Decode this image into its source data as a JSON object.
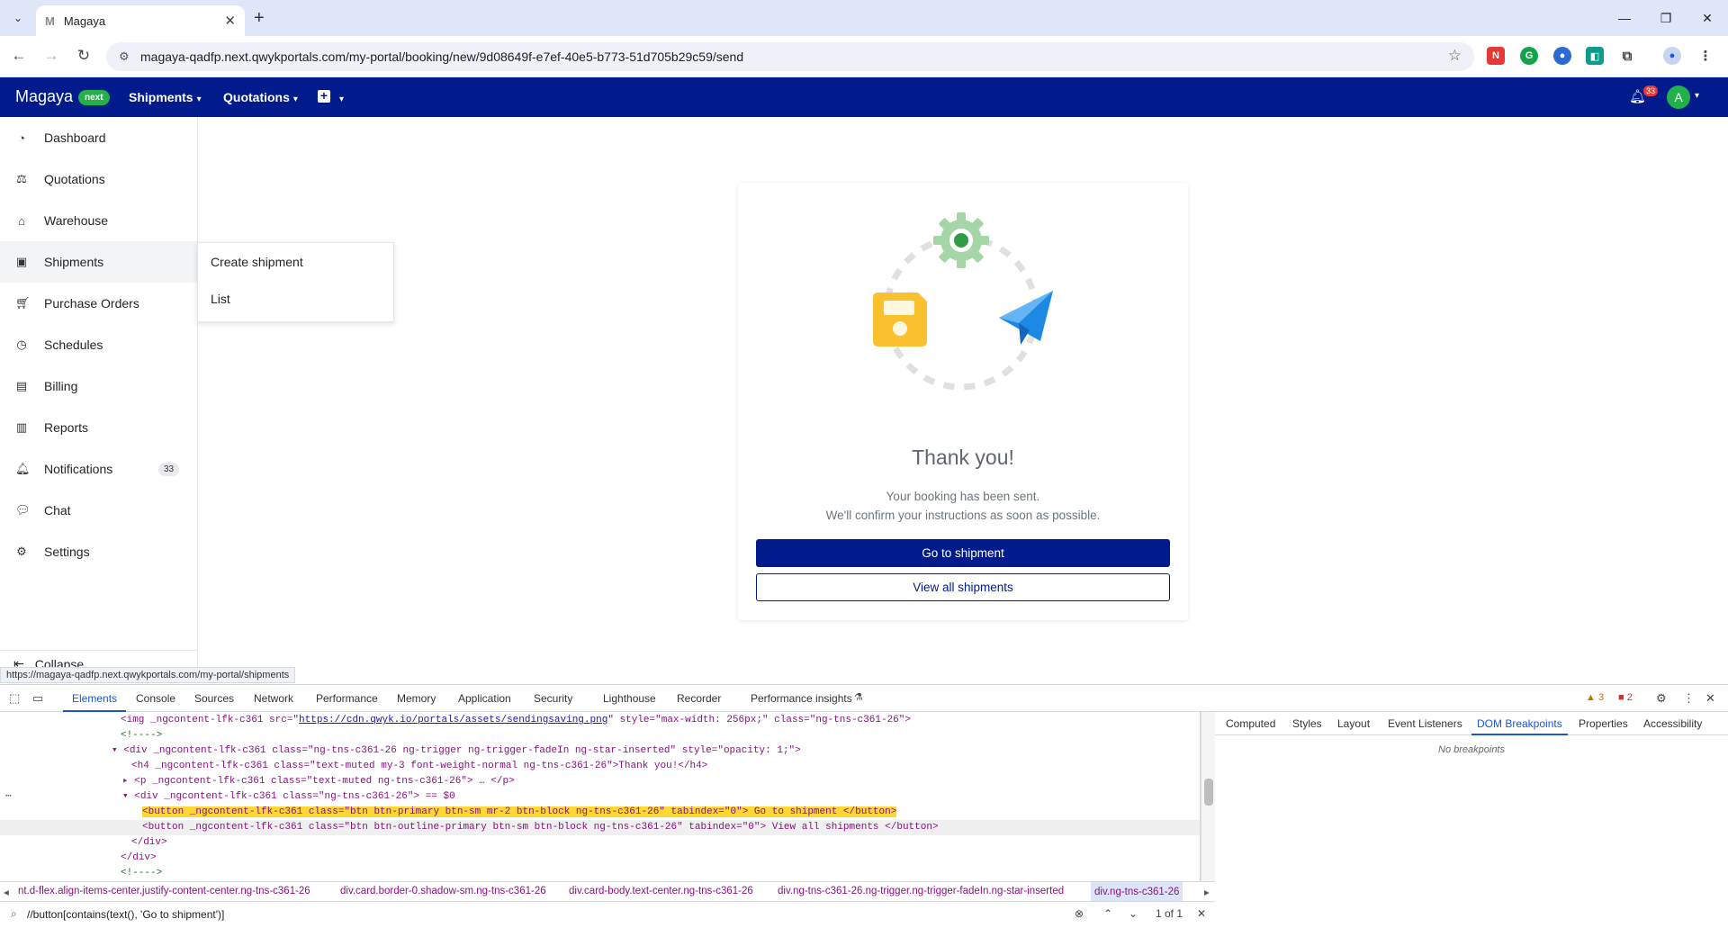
{
  "browser": {
    "tab_title": "Magaya",
    "tab_favicon": "M",
    "url": "magaya-qadfp.next.qwykportals.com/my-portal/booking/new/9d08649f-e7ef-40e5-b773-51d705b29c59/send"
  },
  "app": {
    "brand": "Magaya",
    "brand_badge": "next",
    "nav": {
      "shipments": "Shipments",
      "quotations": "Quotations"
    },
    "bell_count": "33",
    "avatar_initial": "A",
    "colors": {
      "primary": "#021b8c",
      "green": "#22b04b",
      "accent_yellow": "#fbc02d",
      "accent_blue": "#1e88e5"
    }
  },
  "sidebar": {
    "items": [
      {
        "label": "Dashboard",
        "icon": "gauge-icon"
      },
      {
        "label": "Quotations",
        "icon": "scale-icon"
      },
      {
        "label": "Warehouse",
        "icon": "warehouse-icon"
      },
      {
        "label": "Shipments",
        "icon": "box-icon"
      },
      {
        "label": "Purchase Orders",
        "icon": "cart-icon"
      },
      {
        "label": "Schedules",
        "icon": "clock-icon"
      },
      {
        "label": "Billing",
        "icon": "billing-icon"
      },
      {
        "label": "Reports",
        "icon": "chart-icon"
      },
      {
        "label": "Notifications",
        "icon": "bell-icon",
        "badge": "33"
      },
      {
        "label": "Chat",
        "icon": "chat-icon"
      },
      {
        "label": "Settings",
        "icon": "gear-icon"
      }
    ],
    "collapse": "Collapse"
  },
  "flyout": {
    "create": "Create shipment",
    "list": "List"
  },
  "card": {
    "title": "Thank you!",
    "line1": "Your booking has been sent.",
    "line2": "We'll confirm your instructions as soon as possible.",
    "primary_btn": "Go to shipment",
    "secondary_btn": "View all shipments"
  },
  "status_link": "https://magaya-qadfp.next.qwykportals.com/my-portal/shipments",
  "devtools": {
    "tabs": [
      "Elements",
      "Console",
      "Sources",
      "Network",
      "Performance",
      "Memory",
      "Application",
      "Security",
      "Lighthouse",
      "Recorder",
      "Performance insights"
    ],
    "warnings": "3",
    "errors": "2",
    "code": {
      "l1_a": "<img _ngcontent-lfk-c361 src=\"",
      "l1_link": "https://cdn.qwyk.io/portals/assets/sendingsaving.png",
      "l1_b": "\" style=\"max-width: 256px;\" class=\"ng-tns-c361-26\">",
      "l2": "<!---->",
      "l3": "<div _ngcontent-lfk-c361 class=\"ng-tns-c361-26 ng-trigger ng-trigger-fadeIn ng-star-inserted\" style=\"opacity: 1;\">",
      "l4": "<h4 _ngcontent-lfk-c361 class=\"text-muted my-3 font-weight-normal ng-tns-c361-26\">Thank you!</h4>",
      "l5": "<p _ngcontent-lfk-c361 class=\"text-muted ng-tns-c361-26\"> … </p>",
      "l6": "<div _ngcontent-lfk-c361 class=\"ng-tns-c361-26\"> == $0",
      "l7": "<button _ngcontent-lfk-c361 class=\"btn btn-primary btn-sm mr-2 btn-block ng-tns-c361-26\" tabindex=\"0\"> Go to shipment </button>",
      "l8": "<button _ngcontent-lfk-c361 class=\"btn btn-outline-primary btn-sm btn-block ng-tns-c361-26\" tabindex=\"0\"> View all shipments </button>",
      "l9": "</div>",
      "l10": "</div>",
      "l11": "<!---->"
    },
    "crumbs": [
      "nt.d-flex.align-items-center.justify-content-center.ng-tns-c361-26",
      "div.card.border-0.shadow-sm.ng-tns-c361-26",
      "div.card-body.text-center.ng-tns-c361-26",
      "div.ng-tns-c361-26.ng-trigger.ng-trigger-fadeIn.ng-star-inserted",
      "div.ng-tns-c361-26"
    ],
    "search_query": "//button[contains(text(), 'Go to shipment')]",
    "search_count": "1 of 1",
    "side_tabs": [
      "Computed",
      "Styles",
      "Layout",
      "Event Listeners",
      "DOM Breakpoints",
      "Properties",
      "Accessibility"
    ],
    "no_breakpoints": "No breakpoints"
  }
}
